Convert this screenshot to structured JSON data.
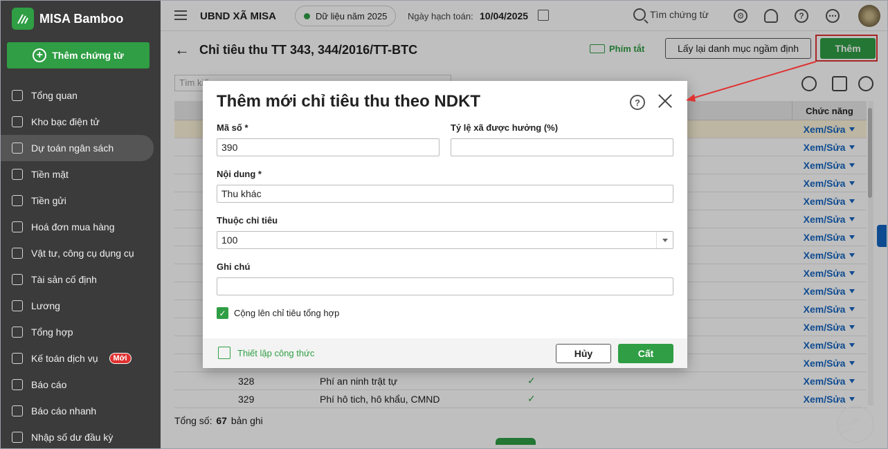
{
  "app": {
    "name": "MISA Bamboo",
    "new_voucher": "Thêm chứng từ"
  },
  "sidebar": {
    "items": [
      {
        "label": "Tổng quan",
        "icon": "dashboard-icon"
      },
      {
        "label": "Kho bạc điện tử",
        "icon": "treasury-icon"
      },
      {
        "label": "Dự toán ngân sách",
        "icon": "budget-icon",
        "active": true
      },
      {
        "label": "Tiền mặt",
        "icon": "cash-icon"
      },
      {
        "label": "Tiền gửi",
        "icon": "deposit-icon"
      },
      {
        "label": "Hoá đơn mua hàng",
        "icon": "invoice-icon"
      },
      {
        "label": "Vật tư, công cụ dụng cụ",
        "icon": "tools-icon"
      },
      {
        "label": "Tài sản cố định",
        "icon": "asset-icon"
      },
      {
        "label": "Lương",
        "icon": "salary-icon"
      },
      {
        "label": "Tổng hợp",
        "icon": "summary-icon"
      },
      {
        "label": "Kế toán dịch vụ",
        "icon": "service-icon",
        "badge": "Mới"
      },
      {
        "label": "Báo cáo",
        "icon": "report-icon"
      },
      {
        "label": "Báo cáo nhanh",
        "icon": "quick-report-icon"
      },
      {
        "label": "Nhập số dư đầu kỳ",
        "icon": "opening-balance-icon"
      }
    ]
  },
  "topbar": {
    "org": "UBND XÃ MISA",
    "data_year": "Dữ liệu năm 2025",
    "post_date_label": "Ngày hạch toán:",
    "post_date": "10/04/2025",
    "search": "Tìm chứng từ"
  },
  "page": {
    "title": "Chỉ tiêu thu TT 343, 344/2016/TT-BTC",
    "shortcut": "Phím tắt",
    "reset_button": "Lấy lại danh mục ngầm định",
    "add_button": "Thêm",
    "search_placeholder": "Tìm kiếm",
    "fn_header": "Chức năng",
    "row_action": "Xem/Sửa",
    "rows": [
      {
        "code": "328",
        "name": "Phí an ninh trật tự",
        "checked": "✓"
      },
      {
        "code": "329",
        "name": "Phí hô tich, hô khẩu, CMND",
        "checked": "✓"
      }
    ],
    "total_label": "Tổng số:",
    "total_count": "67",
    "total_unit": "bản ghi"
  },
  "dialog": {
    "title": "Thêm mới chỉ tiêu thu theo NDKT",
    "code_label": "Mã số *",
    "code_value": "390",
    "rate_label": "Tỷ lệ xã được hưởng (%)",
    "rate_value": "",
    "content_label": "Nội dung *",
    "content_value": "Thu khác",
    "parent_label": "Thuộc chỉ tiêu",
    "parent_value": "100",
    "note_label": "Ghi chú",
    "note_value": "",
    "rollup_label": "Cộng lên chỉ tiêu tổng hợp",
    "formula": "Thiết lập công thức",
    "cancel": "Hủy",
    "save": "Cất"
  },
  "watermark": "DỮ LIỆU MẪU",
  "colors": {
    "brand": "#2f9e44",
    "sidebar": "#3b3b3b",
    "link": "#1565c0",
    "annotation": "#e03131"
  }
}
